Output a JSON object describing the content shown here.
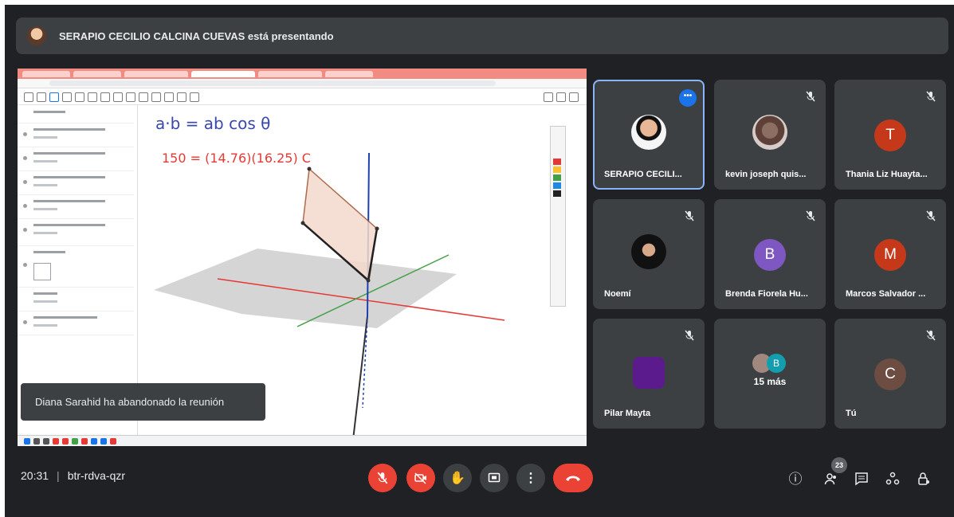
{
  "banner": {
    "presenter_text": "SERAPIO CECILIO CALCINA CUEVAS está presentando"
  },
  "shared_screen": {
    "handwriting_line1": "a·b = ab cos θ",
    "handwriting_line2": "150 = (14.76)(16.25) C"
  },
  "toast": {
    "message": "Diana Sarahid ha abandonado la reunión"
  },
  "tiles": [
    {
      "name": "SERAPIO CECILI...",
      "kind": "photo",
      "selected": true
    },
    {
      "name": "kevin joseph quis...",
      "kind": "photo",
      "muted": true
    },
    {
      "name": "Thania Liz Huayta...",
      "kind": "letter",
      "letter": "T",
      "color": "#c5391a",
      "muted": true
    },
    {
      "name": "Noemí",
      "kind": "photo",
      "muted": true
    },
    {
      "name": "Brenda Fiorela Hu...",
      "kind": "letter",
      "letter": "B",
      "color": "#7e57c2",
      "muted": true
    },
    {
      "name": "Marcos Salvador ...",
      "kind": "letter",
      "letter": "M",
      "color": "#c5391a",
      "muted": true
    },
    {
      "name": "Pilar Mayta",
      "kind": "photo",
      "muted": true
    },
    {
      "name": "15 más",
      "kind": "group",
      "letter": "B",
      "color": "#129eaf"
    },
    {
      "name": "Tú",
      "kind": "letter",
      "letter": "C",
      "color": "#6d4c41",
      "muted": true
    }
  ],
  "footer": {
    "time": "20:31",
    "separator": "|",
    "meeting_code": "btr-rdva-qzr",
    "participants_count": "23"
  },
  "colors": {
    "background": "#202124",
    "tile": "#3c4043",
    "danger": "#ea4335",
    "accent": "#1a73e8"
  }
}
